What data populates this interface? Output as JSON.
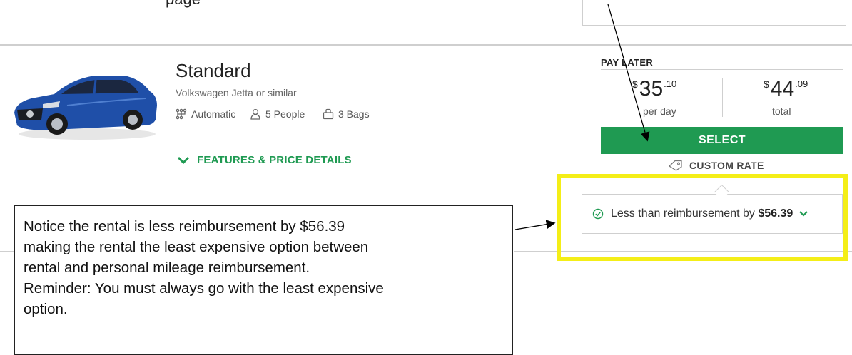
{
  "header": {
    "partial_text": "page"
  },
  "vehicle": {
    "class": "Standard",
    "model": "Volkswagen Jetta or similar",
    "transmission": "Automatic",
    "people": "5 People",
    "bags": "3 Bags",
    "details_link": "FEATURES & PRICE DETAILS",
    "body_color": "#1f4fa8"
  },
  "pricing": {
    "label": "PAY LATER",
    "daily": {
      "symbol": "$",
      "dollars": "35",
      "cents": ".10",
      "caption": "per day"
    },
    "total": {
      "symbol": "$",
      "dollars": "44",
      "cents": ".09",
      "caption": "total"
    },
    "select_label": "SELECT",
    "custom_rate_label": "CUSTOM RATE",
    "accent_color": "#1f9a52"
  },
  "reimbursement": {
    "text": "Less than reimbursement by",
    "amount": "$56.39",
    "highlight_color": "#f4ee17"
  },
  "callout": {
    "lines": [
      "Notice the rental is less reimbursement by $56.39",
      "making the rental the least expensive option between",
      "rental and personal mileage reimbursement.",
      "Reminder: You must always go with the least expensive",
      "option."
    ]
  }
}
